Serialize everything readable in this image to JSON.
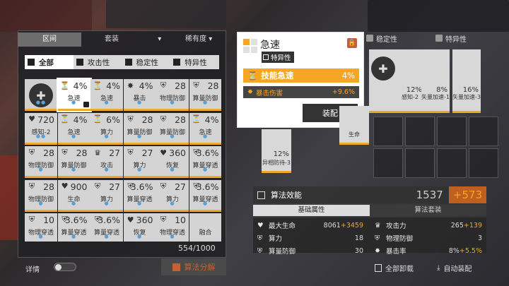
{
  "left_panel": {
    "tab_region": "区间",
    "dropdown_set": "套装",
    "dropdown_rarity": "稀有度",
    "filters": [
      "全部",
      "攻击性",
      "稳定性",
      "特异性"
    ],
    "chips": [
      {
        "row": 0,
        "col": 0,
        "type": "hex",
        "value": "",
        "name": "",
        "dots": "●●"
      },
      {
        "row": 0,
        "col": 1,
        "type": "stat",
        "icon": "⏳",
        "value": "4%",
        "name": "急速",
        "selected": true,
        "locked": true,
        "dots": "●"
      },
      {
        "row": 0,
        "col": 2,
        "type": "stat",
        "icon": "⏳",
        "value": "4%",
        "name": "急速",
        "dots": "●"
      },
      {
        "row": 0,
        "col": 3,
        "type": "stat",
        "icon": "✸",
        "value": "4%",
        "name": "暴击",
        "dots": "●"
      },
      {
        "row": 0,
        "col": 4,
        "type": "stat",
        "icon": "⛨",
        "value": "28",
        "name": "物理防御",
        "dots": "●"
      },
      {
        "row": 0,
        "col": 5,
        "type": "stat",
        "icon": "⛨",
        "value": "28",
        "name": "算量防御",
        "dots": "●"
      },
      {
        "row": 1,
        "col": 0,
        "type": "stat",
        "icon": "♥",
        "value": "720",
        "name": "感知-2",
        "dots": "●●"
      },
      {
        "row": 1,
        "col": 1,
        "type": "stat",
        "icon": "⏳",
        "value": "4%",
        "name": "急速",
        "dots": "●"
      },
      {
        "row": 1,
        "col": 2,
        "type": "stat",
        "icon": "⏳",
        "value": "6%",
        "name": "算力",
        "dots": "●"
      },
      {
        "row": 1,
        "col": 3,
        "type": "stat",
        "icon": "⛨",
        "value": "28",
        "name": "算量防御",
        "dots": "●"
      },
      {
        "row": 1,
        "col": 4,
        "type": "stat",
        "icon": "⛨",
        "value": "28",
        "name": "算量防御",
        "dots": "●"
      },
      {
        "row": 1,
        "col": 5,
        "type": "stat",
        "icon": "⏳",
        "value": "4%",
        "name": "急速",
        "dots": "●"
      },
      {
        "row": 2,
        "col": 0,
        "type": "stat",
        "icon": "⛨",
        "value": "28",
        "name": "物理防御",
        "dots": "●"
      },
      {
        "row": 2,
        "col": 1,
        "type": "stat",
        "icon": "⛨",
        "value": "28",
        "name": "算量防御",
        "dots": "●"
      },
      {
        "row": 2,
        "col": 2,
        "type": "stat",
        "icon": "♛",
        "value": "27",
        "name": "攻击",
        "dots": "●"
      },
      {
        "row": 2,
        "col": 3,
        "type": "stat",
        "icon": "⛨",
        "value": "27",
        "name": "算力",
        "dots": "●"
      },
      {
        "row": 2,
        "col": 4,
        "type": "stat",
        "icon": "♥",
        "value": "360",
        "name": "恢复",
        "dots": "●"
      },
      {
        "row": 2,
        "col": 5,
        "type": "stat",
        "icon": "⛨",
        "value": "3.6%",
        "name": "算量穿透",
        "dots": "●"
      },
      {
        "row": 3,
        "col": 0,
        "type": "stat",
        "icon": "⛨",
        "value": "28",
        "name": "物理防御",
        "dots": "●"
      },
      {
        "row": 3,
        "col": 1,
        "type": "stat",
        "icon": "♥",
        "value": "900",
        "name": "生命",
        "dots": "●"
      },
      {
        "row": 3,
        "col": 2,
        "type": "stat",
        "icon": "⛨",
        "value": "27",
        "name": "算力",
        "dots": "●"
      },
      {
        "row": 3,
        "col": 3,
        "type": "stat",
        "icon": "⛨",
        "value": "3.6%",
        "name": "算量穿透",
        "dots": "●"
      },
      {
        "row": 3,
        "col": 4,
        "type": "stat",
        "icon": "⛨",
        "value": "27",
        "name": "算力",
        "dots": "●"
      },
      {
        "row": 3,
        "col": 5,
        "type": "stat",
        "icon": "⛨",
        "value": "3.6%",
        "name": "算量穿透",
        "dots": "●"
      },
      {
        "row": 4,
        "col": 0,
        "type": "stat",
        "icon": "⛨",
        "value": "10",
        "name": "物理穿透",
        "dots": "●"
      },
      {
        "row": 4,
        "col": 1,
        "type": "stat",
        "icon": "⛨",
        "value": "3.6%",
        "name": "算量穿透",
        "dots": "●"
      },
      {
        "row": 4,
        "col": 2,
        "type": "stat",
        "icon": "⛨",
        "value": "3.6%",
        "name": "算量穿透",
        "dots": "●"
      },
      {
        "row": 4,
        "col": 3,
        "type": "stat",
        "icon": "♥",
        "value": "360",
        "name": "恢复",
        "dots": "●"
      },
      {
        "row": 4,
        "col": 4,
        "type": "stat",
        "icon": "⛨",
        "value": "10",
        "name": "物理穿透",
        "dots": "●"
      },
      {
        "row": 4,
        "col": 5,
        "type": "stat",
        "icon": "",
        "value": "",
        "name": "融合",
        "dots": ""
      }
    ],
    "count": "554/1000",
    "detail_label": "详情",
    "decompose_label": "算法分解"
  },
  "popup": {
    "title": "急速",
    "type_chip": "特异性",
    "main_stat_name": "技能急速",
    "main_stat_value": "4%",
    "sub_stat_name": "暴击伤害",
    "sub_stat_value": "+9.6%",
    "equip_label": "装配"
  },
  "right_panel": {
    "header_stability": "稳定性",
    "header_special": "特异性",
    "stability_chips": [
      {
        "value": "",
        "name": ""
      },
      {
        "value": "12%",
        "name": "感知-2"
      }
    ],
    "special_chips": [
      {
        "value": "8%",
        "name": "矢量加速-1"
      },
      {
        "value": "16%",
        "name": "矢量加速-3"
      }
    ],
    "attack_chips": [
      {
        "value": "",
        "name": "生命"
      },
      {
        "value": "12%",
        "name": "异相防待-3"
      }
    ],
    "power_label": "算法效能",
    "power_value": "1537",
    "power_plus": "+573",
    "tab_basic": "基础属性",
    "tab_set": "算法套装",
    "stats": [
      {
        "icon": "♥",
        "key": "最大生命",
        "val": "8061",
        "bonus": "+3459"
      },
      {
        "icon": "♛",
        "key": "攻击力",
        "val": "265",
        "bonus": "+139"
      },
      {
        "icon": "⛨",
        "key": "算力",
        "val": "18",
        "bonus": ""
      },
      {
        "icon": "⛨",
        "key": "物理防御",
        "val": "3",
        "bonus": ""
      },
      {
        "icon": "⛨",
        "key": "算量防御",
        "val": "30",
        "bonus": ""
      },
      {
        "icon": "✸",
        "key": "暴击率",
        "val": "8%",
        "bonus": "+5.5%"
      }
    ],
    "unload_all": "全部卸载",
    "auto_equip": "自动装配"
  }
}
